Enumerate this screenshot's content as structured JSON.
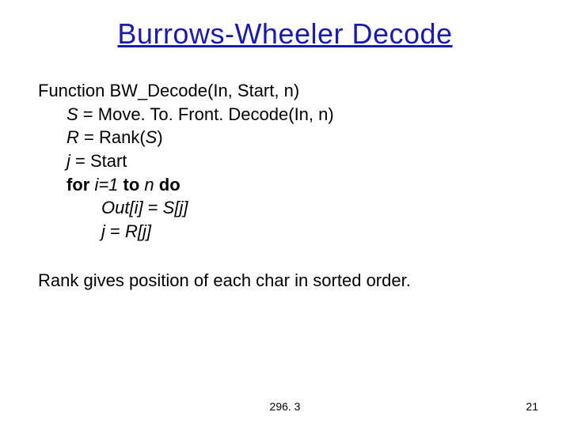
{
  "title": "Burrows-Wheeler Decode",
  "code": {
    "l1_a": "Function ",
    "l1_b": "BW_Decode(In, Start, n)",
    "l2_a": "S",
    "l2_b": " = Move. To. Front. Decode(In, n)",
    "l3_a": "R",
    "l3_b": " = Rank(",
    "l3_c": "S",
    "l3_d": ")",
    "l4_a": "j",
    "l4_b": " = Start",
    "l5_a": "for",
    "l5_b": " i=1 ",
    "l5_c": "to",
    "l5_d": " n ",
    "l5_e": "do",
    "l6_a": "Out[i]",
    "l6_b": " = ",
    "l6_c": "S[j]",
    "l7_a": "j",
    "l7_b": " = ",
    "l7_c": "R[j]"
  },
  "note": "Rank gives position of each char in sorted order.",
  "footer_center": "296. 3",
  "footer_right": "21"
}
